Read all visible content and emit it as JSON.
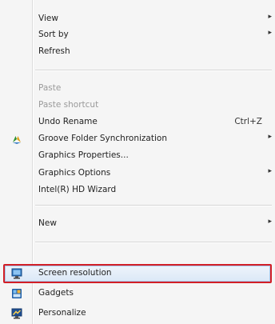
{
  "menu": {
    "items": [
      {
        "label": "View",
        "submenu": true
      },
      {
        "label": "Sort by",
        "submenu": true
      },
      {
        "label": "Refresh"
      },
      {
        "label": "Paste",
        "disabled": true
      },
      {
        "label": "Paste shortcut",
        "disabled": true
      },
      {
        "label": "Undo Rename",
        "shortcut": "Ctrl+Z"
      },
      {
        "label": "Groove Folder Synchronization",
        "submenu": true,
        "icon": "groove-sync-icon"
      },
      {
        "label": "Graphics Properties..."
      },
      {
        "label": "Graphics Options",
        "submenu": true
      },
      {
        "label": "Intel(R) HD Wizard"
      },
      {
        "label": "New",
        "submenu": true
      },
      {
        "label": "Screen resolution",
        "icon": "screen-resolution-icon",
        "highlighted": true
      },
      {
        "label": "Gadgets",
        "icon": "gadgets-icon"
      },
      {
        "label": "Personalize",
        "icon": "personalize-icon"
      }
    ],
    "submenu_arrow": "▸"
  },
  "colors": {
    "background": "#f5f5f5",
    "highlight_border": "#d21f27",
    "disabled_text": "#9a9a9a"
  }
}
